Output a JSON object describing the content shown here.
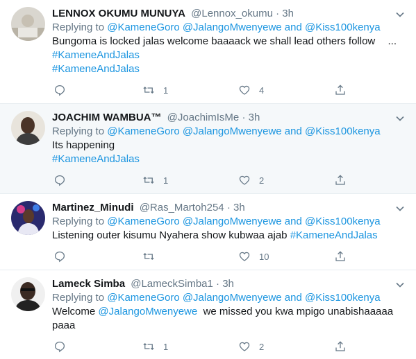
{
  "tweets": [
    {
      "name": "LENNOX OKUMU MUNUYA",
      "handle": "@Lennox_okumu",
      "separator": "·",
      "time": "3h",
      "replying_prefix": "Replying to",
      "replying_to": "@KameneGoro @JalangoMwenyewe and @Kiss100kenya",
      "lines": [
        "Bungoma is locked jalas welcome baaaack we shall lead others follow",
        "#KameneAndJalas",
        "#KameneAndJalas"
      ],
      "ellipsis": "...",
      "retweets": "1",
      "likes": "4",
      "highlight": false
    },
    {
      "name": "JOACHIM WAMBUA™",
      "handle": "@JoachimIsMe",
      "separator": "·",
      "time": "3h",
      "replying_prefix": "Replying to",
      "replying_to": "@KameneGoro @JalangoMwenyewe and @Kiss100kenya",
      "lines": [
        "Its happening",
        "#KameneAndJalas"
      ],
      "retweets": "1",
      "likes": "2",
      "highlight": true
    },
    {
      "name": "Martinez_Minudi",
      "handle": "@Ras_Martoh254",
      "separator": "·",
      "time": "3h",
      "replying_prefix": "Replying to",
      "replying_to": "@KameneGoro @JalangoMwenyewe and @Kiss100kenya",
      "text_plain": "Listening outer kisumu Nyahera show kubwaa ajab ",
      "text_tag": "#KameneAndJalas",
      "retweets": "",
      "likes": "10",
      "highlight": false
    },
    {
      "name": "Lameck Simba",
      "handle": "@LameckSimba1",
      "separator": "·",
      "time": "3h",
      "replying_prefix": "Replying to",
      "replying_to": "@KameneGoro @JalangoMwenyewe and @Kiss100kenya",
      "text_prefix": "Welcome ",
      "text_mention": "@JalangoMwenyewe",
      "text_suffix": "  we missed you kwa mpigo unabishaaaaa",
      "text_line2": "paaa",
      "retweets": "1",
      "likes": "2",
      "highlight": false
    }
  ],
  "colors": {
    "link": "#1b95e0",
    "muted": "#657786",
    "text": "#14171a",
    "highlight_bg": "#f5f8fa",
    "divider": "#e6ecf0"
  },
  "icons": [
    "reply-icon",
    "retweet-icon",
    "like-icon",
    "share-icon",
    "chevron-down-icon"
  ]
}
